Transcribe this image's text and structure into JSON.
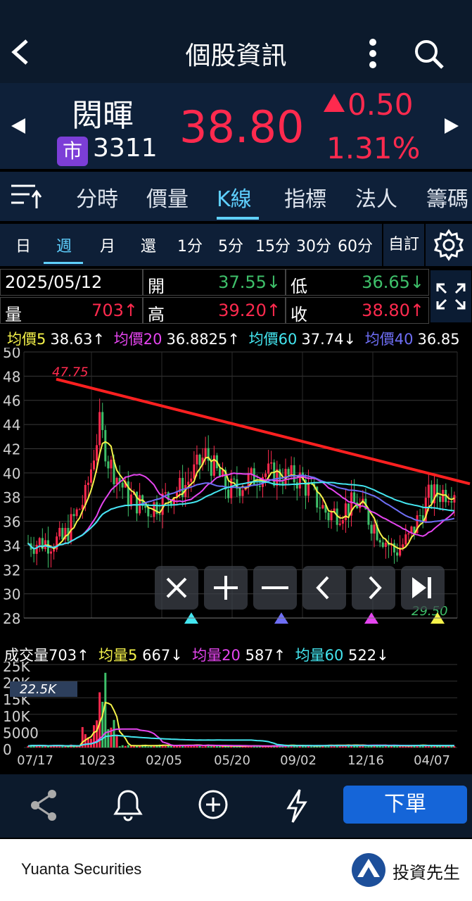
{
  "header": {
    "title": "個股資訊"
  },
  "quote": {
    "name": "閎暉",
    "market": "市",
    "code": "3311",
    "price": "38.80",
    "change": "0.50",
    "change_pct": "1.31%"
  },
  "tabs": [
    "分時",
    "價量",
    "K線",
    "指標",
    "法人",
    "籌碼"
  ],
  "active_tab": "K線",
  "periods": [
    "日",
    "週",
    "月",
    "還",
    "1分",
    "5分",
    "15分",
    "30分",
    "60分"
  ],
  "active_period": "週",
  "custom_label": "自訂",
  "info": {
    "date": "2025/05/12",
    "open_label": "開",
    "open": "37.55↓",
    "low_label": "低",
    "low": "36.65↓",
    "vol_label": "量",
    "vol": "703↑",
    "high_label": "高",
    "high": "39.20↑",
    "close_label": "收",
    "close": "38.80↑"
  },
  "ma": [
    {
      "label": "均價5",
      "value": "38.63↑",
      "color": "#f5f24a"
    },
    {
      "label": "均價20",
      "value": "36.8825↑",
      "color": "#e545ef"
    },
    {
      "label": "均價60",
      "value": "37.74↓",
      "color": "#44e6f0"
    },
    {
      "label": "均價40",
      "value": "36.85",
      "color": "#6e6ef5"
    }
  ],
  "chart_data": {
    "type": "candlestick",
    "y_ticks": [
      "50",
      "48",
      "46",
      "44",
      "42",
      "40",
      "38",
      "36",
      "34",
      "32",
      "30",
      "28"
    ],
    "ylim": [
      28,
      50
    ],
    "max_label": "47.75",
    "min_label": "29.50",
    "x_ticks": [
      "07/17",
      "10/23",
      "02/05",
      "05/20",
      "09/02",
      "12/16",
      "04/07"
    ],
    "vol_ticks": [
      "25K",
      "20K",
      "15K",
      "10K",
      "5000",
      "0"
    ],
    "vol_max_label": "22.5K"
  },
  "vol_legend": [
    {
      "label": "成交量",
      "value": "703↑",
      "color": "#ffffff"
    },
    {
      "label": "均量5",
      "value": "667↓",
      "color": "#f5f24a"
    },
    {
      "label": "均量20",
      "value": "587↑",
      "color": "#e545ef"
    },
    {
      "label": "均量60",
      "value": "522↓",
      "color": "#44e6f0"
    }
  ],
  "order_label": "下單",
  "footer": {
    "brand": "Yuanta Securities",
    "app_name": "投資先生"
  },
  "icons": [
    "back-icon",
    "more-icon",
    "search-icon",
    "menu-icon",
    "gear-icon",
    "expand-icon",
    "share-icon",
    "bell-icon",
    "add-icon",
    "flash-icon"
  ]
}
